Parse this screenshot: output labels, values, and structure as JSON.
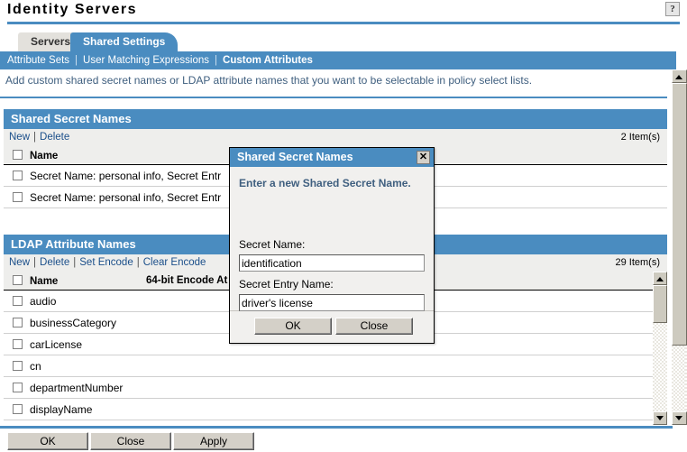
{
  "header": {
    "title": "Identity Servers",
    "help_label": "?"
  },
  "tabs": [
    {
      "label": "Servers",
      "active": false
    },
    {
      "label": "Shared Settings",
      "active": true
    }
  ],
  "subnav": {
    "items": [
      {
        "label": "Attribute Sets",
        "current": false
      },
      {
        "label": "User Matching Expressions",
        "current": false
      },
      {
        "label": "Custom Attributes",
        "current": true
      }
    ],
    "separator": "|"
  },
  "content": {
    "intro": "Add custom shared secret names or LDAP attribute names that you want to be selectable in policy select lists."
  },
  "shared_secret_section": {
    "title": "Shared Secret Names",
    "toolbar": [
      {
        "label": "New"
      },
      {
        "label": "Delete"
      }
    ],
    "separator": "|",
    "count": "2 Item(s)",
    "columns": [
      "Name"
    ],
    "rows": [
      {
        "name": "Secret Name: personal info, Secret Entr"
      },
      {
        "name": "Secret Name: personal info, Secret Entr"
      }
    ]
  },
  "ldap_section": {
    "title": "LDAP Attribute Names",
    "toolbar": [
      {
        "label": "New"
      },
      {
        "label": "Delete"
      },
      {
        "label": "Set Encode"
      },
      {
        "label": "Clear Encode"
      }
    ],
    "separator": "|",
    "count": "29 Item(s)",
    "columns": [
      "Name",
      "64-bit Encode At"
    ],
    "rows": [
      {
        "name": "audio"
      },
      {
        "name": "businessCategory"
      },
      {
        "name": "carLicense"
      },
      {
        "name": "cn"
      },
      {
        "name": "departmentNumber"
      },
      {
        "name": "displayName"
      }
    ]
  },
  "footer": {
    "buttons": [
      {
        "label": "OK"
      },
      {
        "label": "Close"
      },
      {
        "label": "Apply"
      }
    ]
  },
  "dialog": {
    "title": "Shared Secret Names",
    "close_label": "✕",
    "instruction": "Enter a new Shared Secret Name.",
    "fields": [
      {
        "label": "Secret Name:",
        "value": "identification"
      },
      {
        "label": "Secret Entry Name:",
        "value": "driver's license"
      }
    ],
    "buttons": [
      {
        "label": "OK"
      },
      {
        "label": "Close"
      }
    ]
  },
  "colors": {
    "accent": "#4a8cc0",
    "panel_header_text": "#ffffff",
    "link": "#1b4f8a",
    "intro_text": "#3f5f7f"
  }
}
